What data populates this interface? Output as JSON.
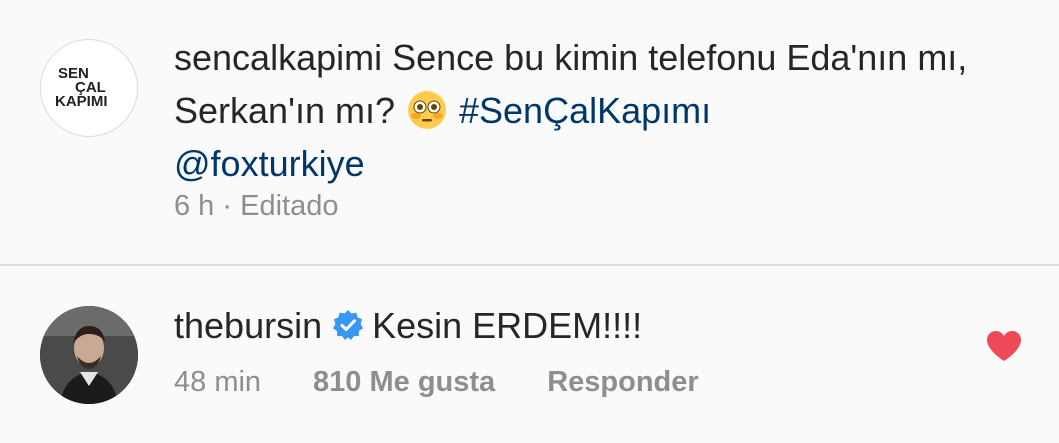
{
  "post": {
    "avatar_lines": [
      "SEN",
      "ÇAL",
      "KAPIMI"
    ],
    "username": "sencalkapimi",
    "caption_text": " Sence bu kimin telefonu Eda'nın mı, Serkan'ın mı? ",
    "emoji": "flushed-face",
    "hashtag": "#SenÇalKapımı",
    "mention": "@foxturkiye",
    "time": "6 h",
    "separator": " · ",
    "edited": "Editado"
  },
  "comment": {
    "username": "thebursin",
    "verified": true,
    "text": "Kesin ERDEM!!!!",
    "time": "48 min",
    "likes": "810 Me gusta",
    "reply": "Responder",
    "liked": true
  },
  "colors": {
    "link": "#00376b",
    "muted": "#8e8e8e",
    "verified_blue": "#3897f0",
    "heart_red": "#ed4956"
  }
}
